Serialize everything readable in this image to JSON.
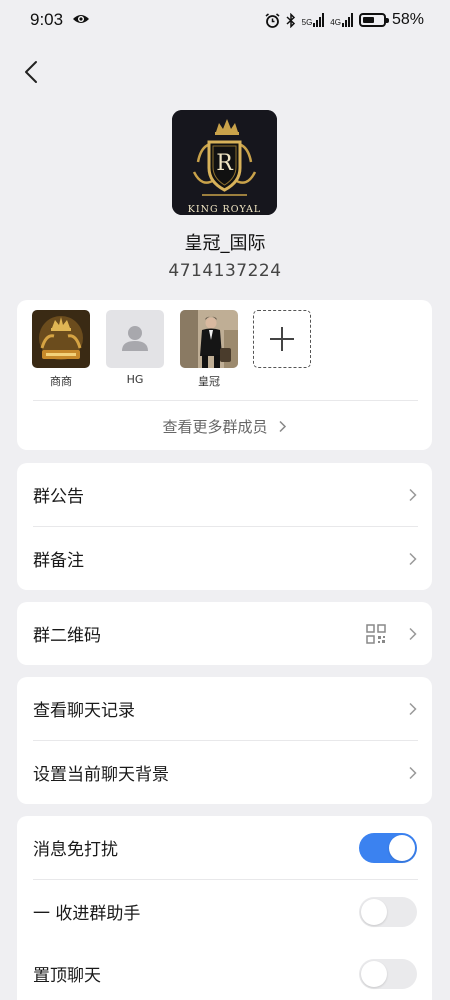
{
  "status_bar": {
    "time": "9:03",
    "network_1": "5G",
    "network_2": "4G",
    "battery_percent": "58%",
    "battery_level": 0.58
  },
  "group": {
    "name": "皇冠_国际",
    "id": "4714137224",
    "avatar_text": "KING ROYAL",
    "avatar_letter": "R"
  },
  "members": [
    {
      "name": "商商"
    },
    {
      "name": "HG"
    },
    {
      "name": "皇冠"
    }
  ],
  "more_members_label": "查看更多群成员",
  "menu": {
    "announcement": "群公告",
    "remark": "群备注",
    "qr_code": "群二维码",
    "chat_history": "查看聊天记录",
    "chat_background": "设置当前聊天背景"
  },
  "toggles": {
    "mute": {
      "label": "消息免打扰",
      "on": true
    },
    "assistant": {
      "label": "一 收进群助手",
      "on": false
    },
    "pin": {
      "label": "置顶聊天",
      "on": false
    }
  },
  "colors": {
    "accent": "#3b82f0",
    "background": "#efeff2"
  }
}
